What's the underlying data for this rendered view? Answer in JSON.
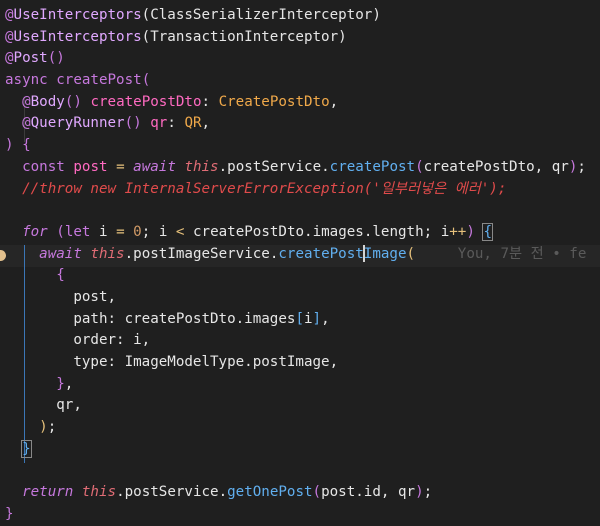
{
  "editor": {
    "lines": [
      "@UseInterceptors(ClassSerializerInterceptor)",
      "@UseInterceptors(TransactionInterceptor)",
      "@Post()",
      "async createPost(",
      "  @Body() createPostDto: CreatePostDto,",
      "  @QueryRunner() qr: QR,",
      ") {",
      "  const post = await this.postService.createPost(createPostDto, qr);",
      "  //throw new InternalServerErrorException('일부러넣은 에러');",
      "",
      "  for (let i = 0; i < createPostDto.images.length; i++) {",
      "    await this.postImageService.createPostImage(",
      "      {",
      "        post,",
      "        path: createPostDto.images[i],",
      "        order: i,",
      "        type: ImageModelType.postImage,",
      "      },",
      "      qr,",
      "    );",
      "  }",
      "",
      "  return this.postService.getOnePost(post.id, qr);",
      "}"
    ],
    "blame_text": "You, 7분 전 • fe",
    "active_line": 12
  }
}
